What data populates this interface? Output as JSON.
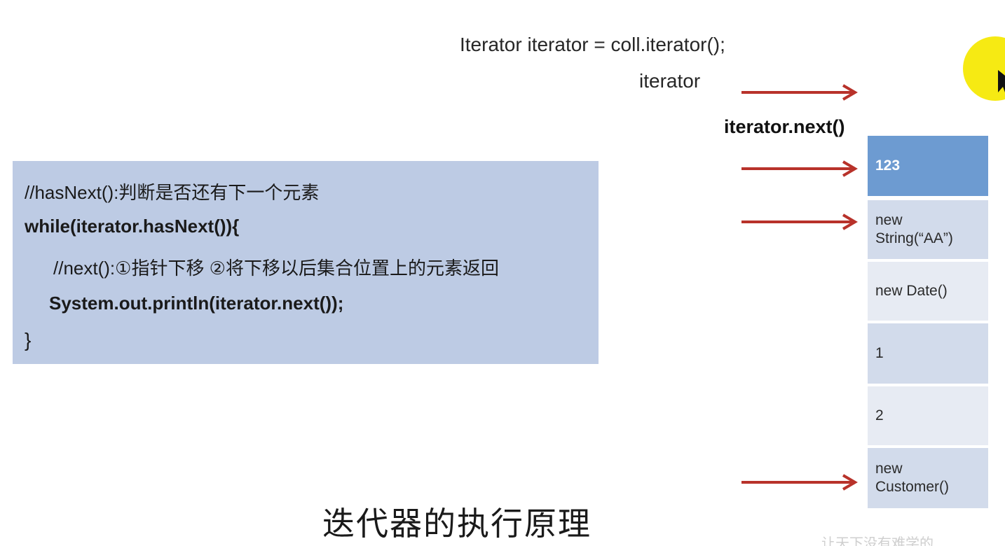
{
  "slide": {
    "iterator_declaration": "Iterator iterator = coll.iterator();",
    "iterator_label": "iterator",
    "next_call_label": "iterator.next()",
    "caption": "迭代器的执行原理",
    "watermark": "让天下没有难学的"
  },
  "code_box": {
    "lines": [
      "//hasNext():判断是否还有下一个元素",
      "while(iterator.hasNext()){",
      "//next():①指针下移 ②将下移以后集合位置上的元素返回",
      "System.out.println(iterator.next());",
      "}"
    ]
  },
  "collection": {
    "elements": [
      "123",
      "new\nString(“AA”)",
      "new Date()",
      "1",
      "2",
      "new\nCustomer()"
    ]
  },
  "colors": {
    "code_background": "#bdcbe4",
    "highlighted_cell": "#6d9bd1",
    "cell_light": "#e7ebf3",
    "cell_dark": "#d2dbeb",
    "arrow": "#b8322a",
    "pointer_highlight": "#f6ea13"
  },
  "icons": {
    "arrow": "right-arrow-icon",
    "pointer": "mouse-pointer-icon"
  }
}
